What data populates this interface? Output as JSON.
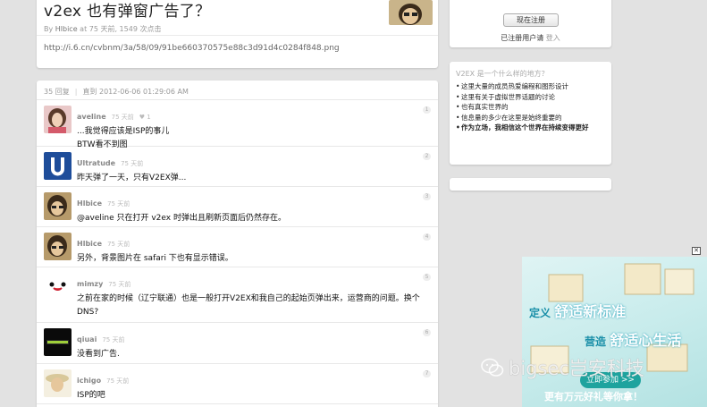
{
  "topic": {
    "title": "v2ex 也有弹窗广告了？",
    "author": "Hlbice",
    "meta_rest": " at 75 天前, 1549 次点击",
    "meta_prefix": "By ",
    "link": "http://i.6.cn/cvbnm/3a/58/09/91be660370575e88c3d91d4c0284f848.png"
  },
  "replies_header": {
    "count": "35 回复",
    "separator": "|",
    "until": "直到 2012-06-06 01:29:06 AM"
  },
  "replies": [
    {
      "author": "aveline",
      "time": "75 天前",
      "heart": "♥ 1",
      "floor": "1",
      "content": "...我觉得应该是ISP的事儿\nBTW看不到图"
    },
    {
      "author": "Ultratude",
      "time": "75 天前",
      "heart": "",
      "floor": "2",
      "content": "昨天弹了一天，只有V2EX弹..."
    },
    {
      "author": "Hlbice",
      "time": "75 天前",
      "heart": "",
      "floor": "3",
      "content": "@aveline 只在打开 v2ex 时弹出且刷新页面后仍然存在。"
    },
    {
      "author": "Hlbice",
      "time": "75 天前",
      "heart": "",
      "floor": "4",
      "content": "另外，背景图片在 safari 下也有显示错误。"
    },
    {
      "author": "mimzy",
      "time": "75 天前",
      "heart": "",
      "floor": "5",
      "content": "之前在家的时候（辽宁联通）也是一般打开V2EX和我自己的起始页弹出来，运营商的问题。换个DNS?"
    },
    {
      "author": "qiuai",
      "time": "75 天前",
      "heart": "",
      "floor": "6",
      "content": "没看到广告."
    },
    {
      "author": "ichigo",
      "time": "75 天前",
      "heart": "",
      "floor": "7",
      "content": "ISP的吧"
    }
  ],
  "sidebar": {
    "register_button": "现在注册",
    "register_hint": "已注册用户请 ",
    "login_link": "登入",
    "about_title": "V2EX 是一个什么样的地方？",
    "about_items": [
      "这里大量的成员热爱编程和图形设计",
      "这里有关于虚拟世界话题的讨论",
      "也有真实世界的",
      "信息量的多少在这里是始终重要的",
      "作为立场，我相信这个世界在持续变得更好"
    ]
  },
  "ad": {
    "close": "✕",
    "line1_a": "定义",
    "line1_b": "舒适新标准",
    "line2_a": "营造",
    "line2_b": "舒适心生活",
    "cta": "立即参加 >>",
    "footer": "更有万元好礼等你拿！"
  },
  "watermark": {
    "text": "bigsec岂安科技"
  }
}
